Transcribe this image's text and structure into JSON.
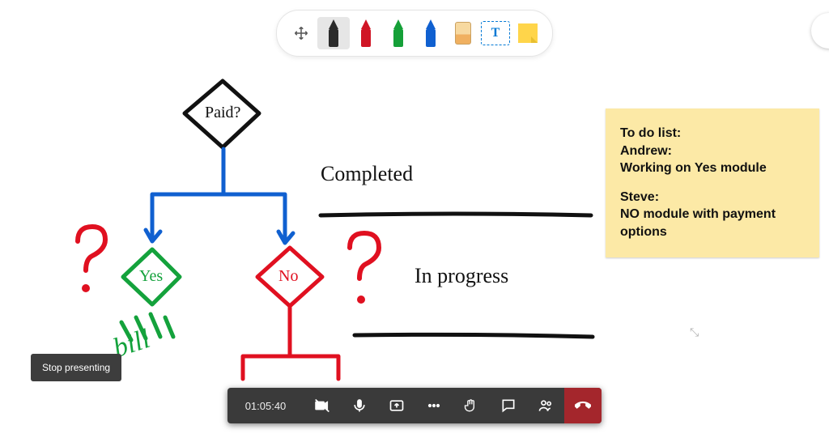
{
  "toolbar": {
    "move_icon": "move",
    "pens": [
      {
        "color": "#2b2b2b",
        "selected": true,
        "name": "pen-black"
      },
      {
        "color": "#d01525",
        "selected": false,
        "name": "pen-red"
      },
      {
        "color": "#15a038",
        "selected": false,
        "name": "pen-green"
      },
      {
        "color": "#1060d0",
        "selected": false,
        "name": "pen-blue"
      }
    ],
    "eraser_icon": "eraser",
    "text_tool": "text",
    "text_tool_label": "T",
    "note_tool": "sticky-note"
  },
  "whiteboard": {
    "paid_label": "Paid?",
    "yes_label": "Yes",
    "no_label": "No",
    "bill_label": "bill",
    "completed_label": "Completed",
    "inprogress_label": "In progress"
  },
  "sticky_note": {
    "line1": "To do list:",
    "line2": "Andrew:",
    "line3": "Working on Yes module",
    "line4": "Steve:",
    "line5": "NO module with payment options"
  },
  "tooltip": {
    "stop_presenting": "Stop presenting"
  },
  "meeting_bar": {
    "time": "01:05:40",
    "buttons": {
      "camera": "camera-off",
      "mic": "microphone",
      "share": "share-screen",
      "more": "more-options",
      "raise_hand": "raise-hand",
      "chat": "chat",
      "participants": "participants",
      "hangup": "hang-up"
    }
  }
}
